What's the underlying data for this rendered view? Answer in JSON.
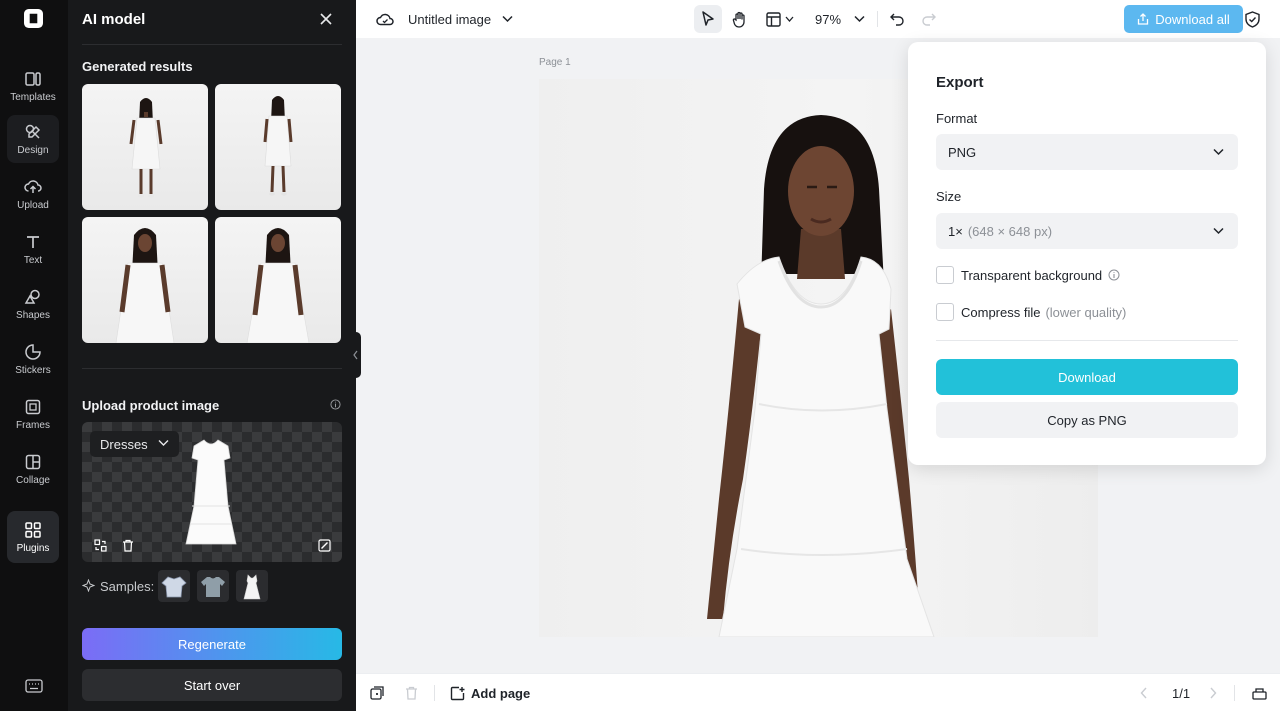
{
  "rail": {
    "items": [
      {
        "label": "Templates",
        "icon": "templates-icon"
      },
      {
        "label": "Design",
        "icon": "design-icon"
      },
      {
        "label": "Upload",
        "icon": "upload-icon"
      },
      {
        "label": "Text",
        "icon": "text-icon"
      },
      {
        "label": "Shapes",
        "icon": "shapes-icon"
      },
      {
        "label": "Stickers",
        "icon": "stickers-icon"
      },
      {
        "label": "Frames",
        "icon": "frames-icon"
      },
      {
        "label": "Collage",
        "icon": "collage-icon"
      },
      {
        "label": "Plugins",
        "icon": "plugins-icon"
      }
    ],
    "active": "Plugins"
  },
  "panel": {
    "title": "AI model",
    "generated_label": "Generated results",
    "upload_label": "Upload product image",
    "category": "Dresses",
    "samples_label": "Samples:",
    "regenerate_label": "Regenerate",
    "start_over_label": "Start over"
  },
  "topbar": {
    "doc_title": "Untitled image",
    "zoom": "97%",
    "download_all_label": "Download all"
  },
  "canvas": {
    "page_label": "Page 1"
  },
  "bottombar": {
    "add_page_label": "Add page",
    "pager": "1/1"
  },
  "export": {
    "title": "Export",
    "format_label": "Format",
    "format_value": "PNG",
    "size_label": "Size",
    "size_value": "1×",
    "size_detail": "(648 × 648 px)",
    "transparent_label": "Transparent background",
    "transparent_checked": false,
    "compress_label": "Compress file",
    "compress_note": "(lower quality)",
    "compress_checked": false,
    "download_label": "Download",
    "copy_label": "Copy as PNG"
  },
  "colors": {
    "accent_cyan": "#22c1d9",
    "download_all_blue": "#5cb8f0",
    "regenerate_gradient_start": "#7b6cf6",
    "regenerate_gradient_end": "#27b9e6",
    "panel_bg": "#18191b"
  }
}
